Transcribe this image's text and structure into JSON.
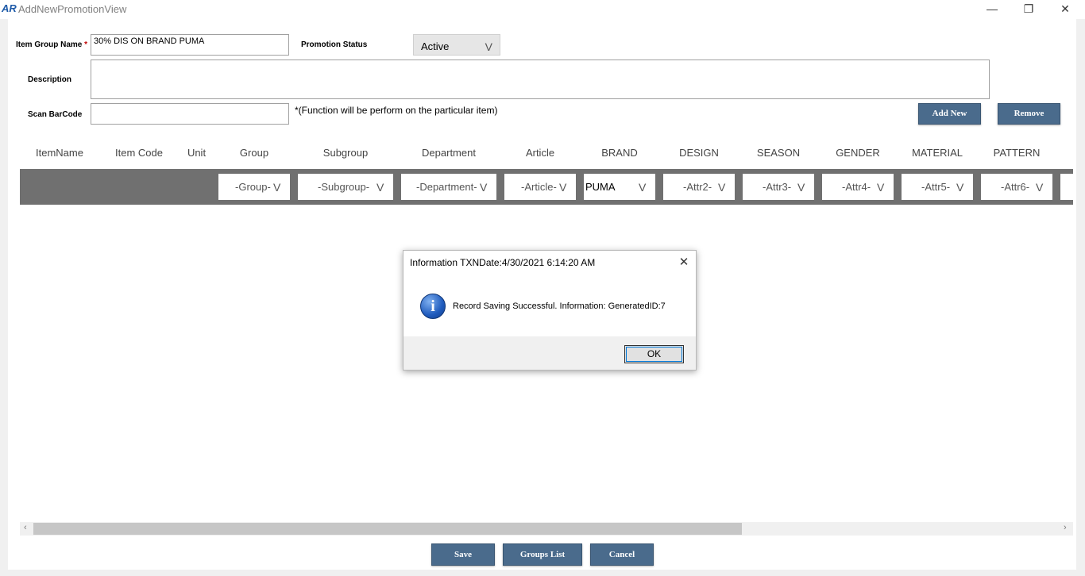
{
  "window": {
    "logo": "AR",
    "title": "AddNewPromotionView",
    "minimize": "—",
    "maximize": "❐",
    "close": "✕"
  },
  "form": {
    "item_group_name_label": "Item Group Name",
    "required_marker": "*",
    "item_group_name_value": "30% DIS ON BRAND PUMA",
    "promotion_status_label": "Promotion Status",
    "promotion_status_value": "Active",
    "description_label": "Description",
    "description_value": "",
    "scan_barcode_label": "Scan BarCode",
    "scan_barcode_value": "",
    "scan_hint": "*(Function will be perform on the particular item)",
    "add_new_label": "Add New",
    "remove_label": "Remove"
  },
  "grid": {
    "columns": [
      "ItemName",
      "Item Code",
      "Unit",
      "Group",
      "Subgroup",
      "Department",
      "Article",
      "BRAND",
      "DESIGN",
      "SEASON",
      "GENDER",
      "MATERIAL",
      "PATTERN"
    ],
    "filters": [
      "-Group-",
      "-Subgroup-",
      "-Department-",
      "-Article-",
      "PUMA",
      "-Attr2-",
      "-Attr3-",
      "-Attr4-",
      "-Attr5-",
      "-Attr6-"
    ],
    "chevron": "V"
  },
  "scrollbar": {
    "left_arrow": "‹",
    "right_arrow": "›"
  },
  "footer": {
    "save_label": "Save",
    "groups_list_label": "Groups List",
    "cancel_label": "Cancel"
  },
  "dialog": {
    "title": "Information TXNDate:4/30/2021 6:14:20 AM",
    "close": "✕",
    "icon": "i",
    "message": "Record Saving Successful. Information: GeneratedID:7",
    "ok_label": "OK"
  },
  "colors": {
    "button_blue": "#4a6b8c",
    "grid_row": "#707070",
    "required": "#c00000"
  }
}
